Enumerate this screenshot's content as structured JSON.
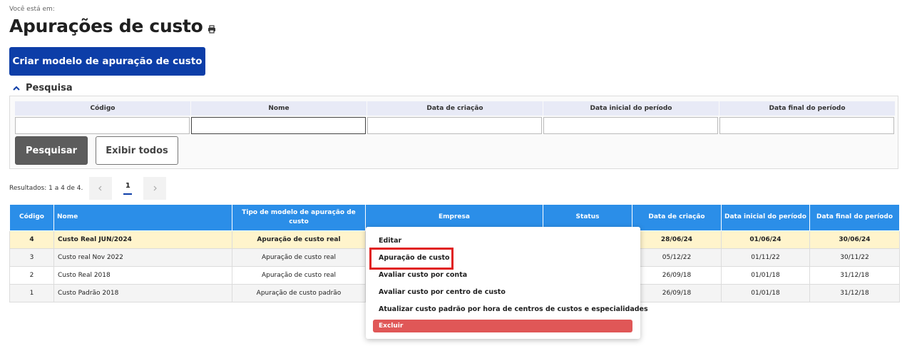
{
  "breadcrumb": "Você está em:",
  "page_title": "Apurações de custo",
  "create_button": "Criar modelo de apuração de custo",
  "search": {
    "label": "Pesquisa",
    "fields": [
      {
        "label": "Código",
        "value": ""
      },
      {
        "label": "Nome",
        "value": ""
      },
      {
        "label": "Data de criação",
        "value": ""
      },
      {
        "label": "Data inicial do período",
        "value": ""
      },
      {
        "label": "Data final do período",
        "value": ""
      }
    ],
    "search_button": "Pesquisar",
    "show_all_button": "Exibir todos"
  },
  "pagination": {
    "results_text": "Resultados: 1 a 4 de 4.",
    "current_page": "1"
  },
  "table": {
    "columns": [
      "Código",
      "Nome",
      "Tipo de modelo de apuração de custo",
      "Empresa",
      "Status",
      "Data de criação",
      "Data inicial do período",
      "Data final do período"
    ],
    "rows": [
      {
        "codigo": "4",
        "nome": "Custo Real JUN/2024",
        "tipo": "Apuração de custo real",
        "empresa": "",
        "status": "",
        "criacao": "28/06/24",
        "inicial": "01/06/24",
        "final": "30/06/24"
      },
      {
        "codigo": "3",
        "nome": "Custo real Nov 2022",
        "tipo": "Apuração de custo real",
        "empresa": "",
        "status": "",
        "criacao": "05/12/22",
        "inicial": "01/11/22",
        "final": "30/11/22"
      },
      {
        "codigo": "2",
        "nome": "Custo Real 2018",
        "tipo": "Apuração de custo real",
        "empresa": "",
        "status": "",
        "criacao": "26/09/18",
        "inicial": "01/01/18",
        "final": "31/12/18"
      },
      {
        "codigo": "1",
        "nome": "Custo Padrão 2018",
        "tipo": "Apuração de custo padrão",
        "empresa": "",
        "status": "",
        "criacao": "26/09/18",
        "inicial": "01/01/18",
        "final": "31/12/18"
      }
    ]
  },
  "context_menu": {
    "items": [
      "Editar",
      "Apuração de custo",
      "Avaliar custo por conta",
      "Avaliar custo por centro de custo",
      "Atualizar custo padrão por hora de centros de custos e especialidades"
    ],
    "delete": "Excluir"
  },
  "colors": {
    "primary": "#0d3ea8",
    "table_header": "#2b8ee8",
    "selected_row": "#fff4cc",
    "delete": "#e05757",
    "highlight": "#e02020"
  }
}
